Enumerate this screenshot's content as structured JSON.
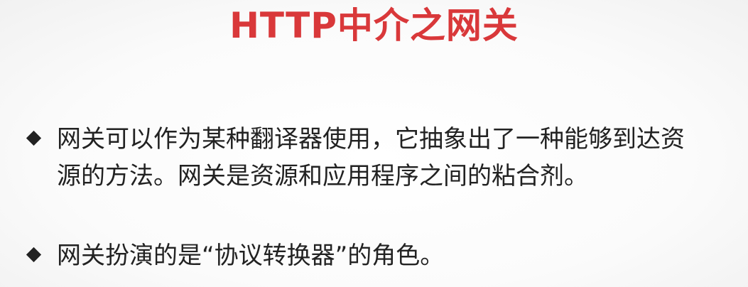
{
  "slide": {
    "title": "HTTP中介之网关",
    "title_color": "#d9383a",
    "text_color": "#222222",
    "bullet_icon": "diamond-bullet-icon",
    "bullets": [
      {
        "text": "网关可以作为某种翻译器使用，它抽象出了一种能够到达资\n源的方法。网关是资源和应用程序之间的粘合剂。"
      },
      {
        "text": "网关扮演的是“协议转换器”的角色。"
      }
    ]
  }
}
